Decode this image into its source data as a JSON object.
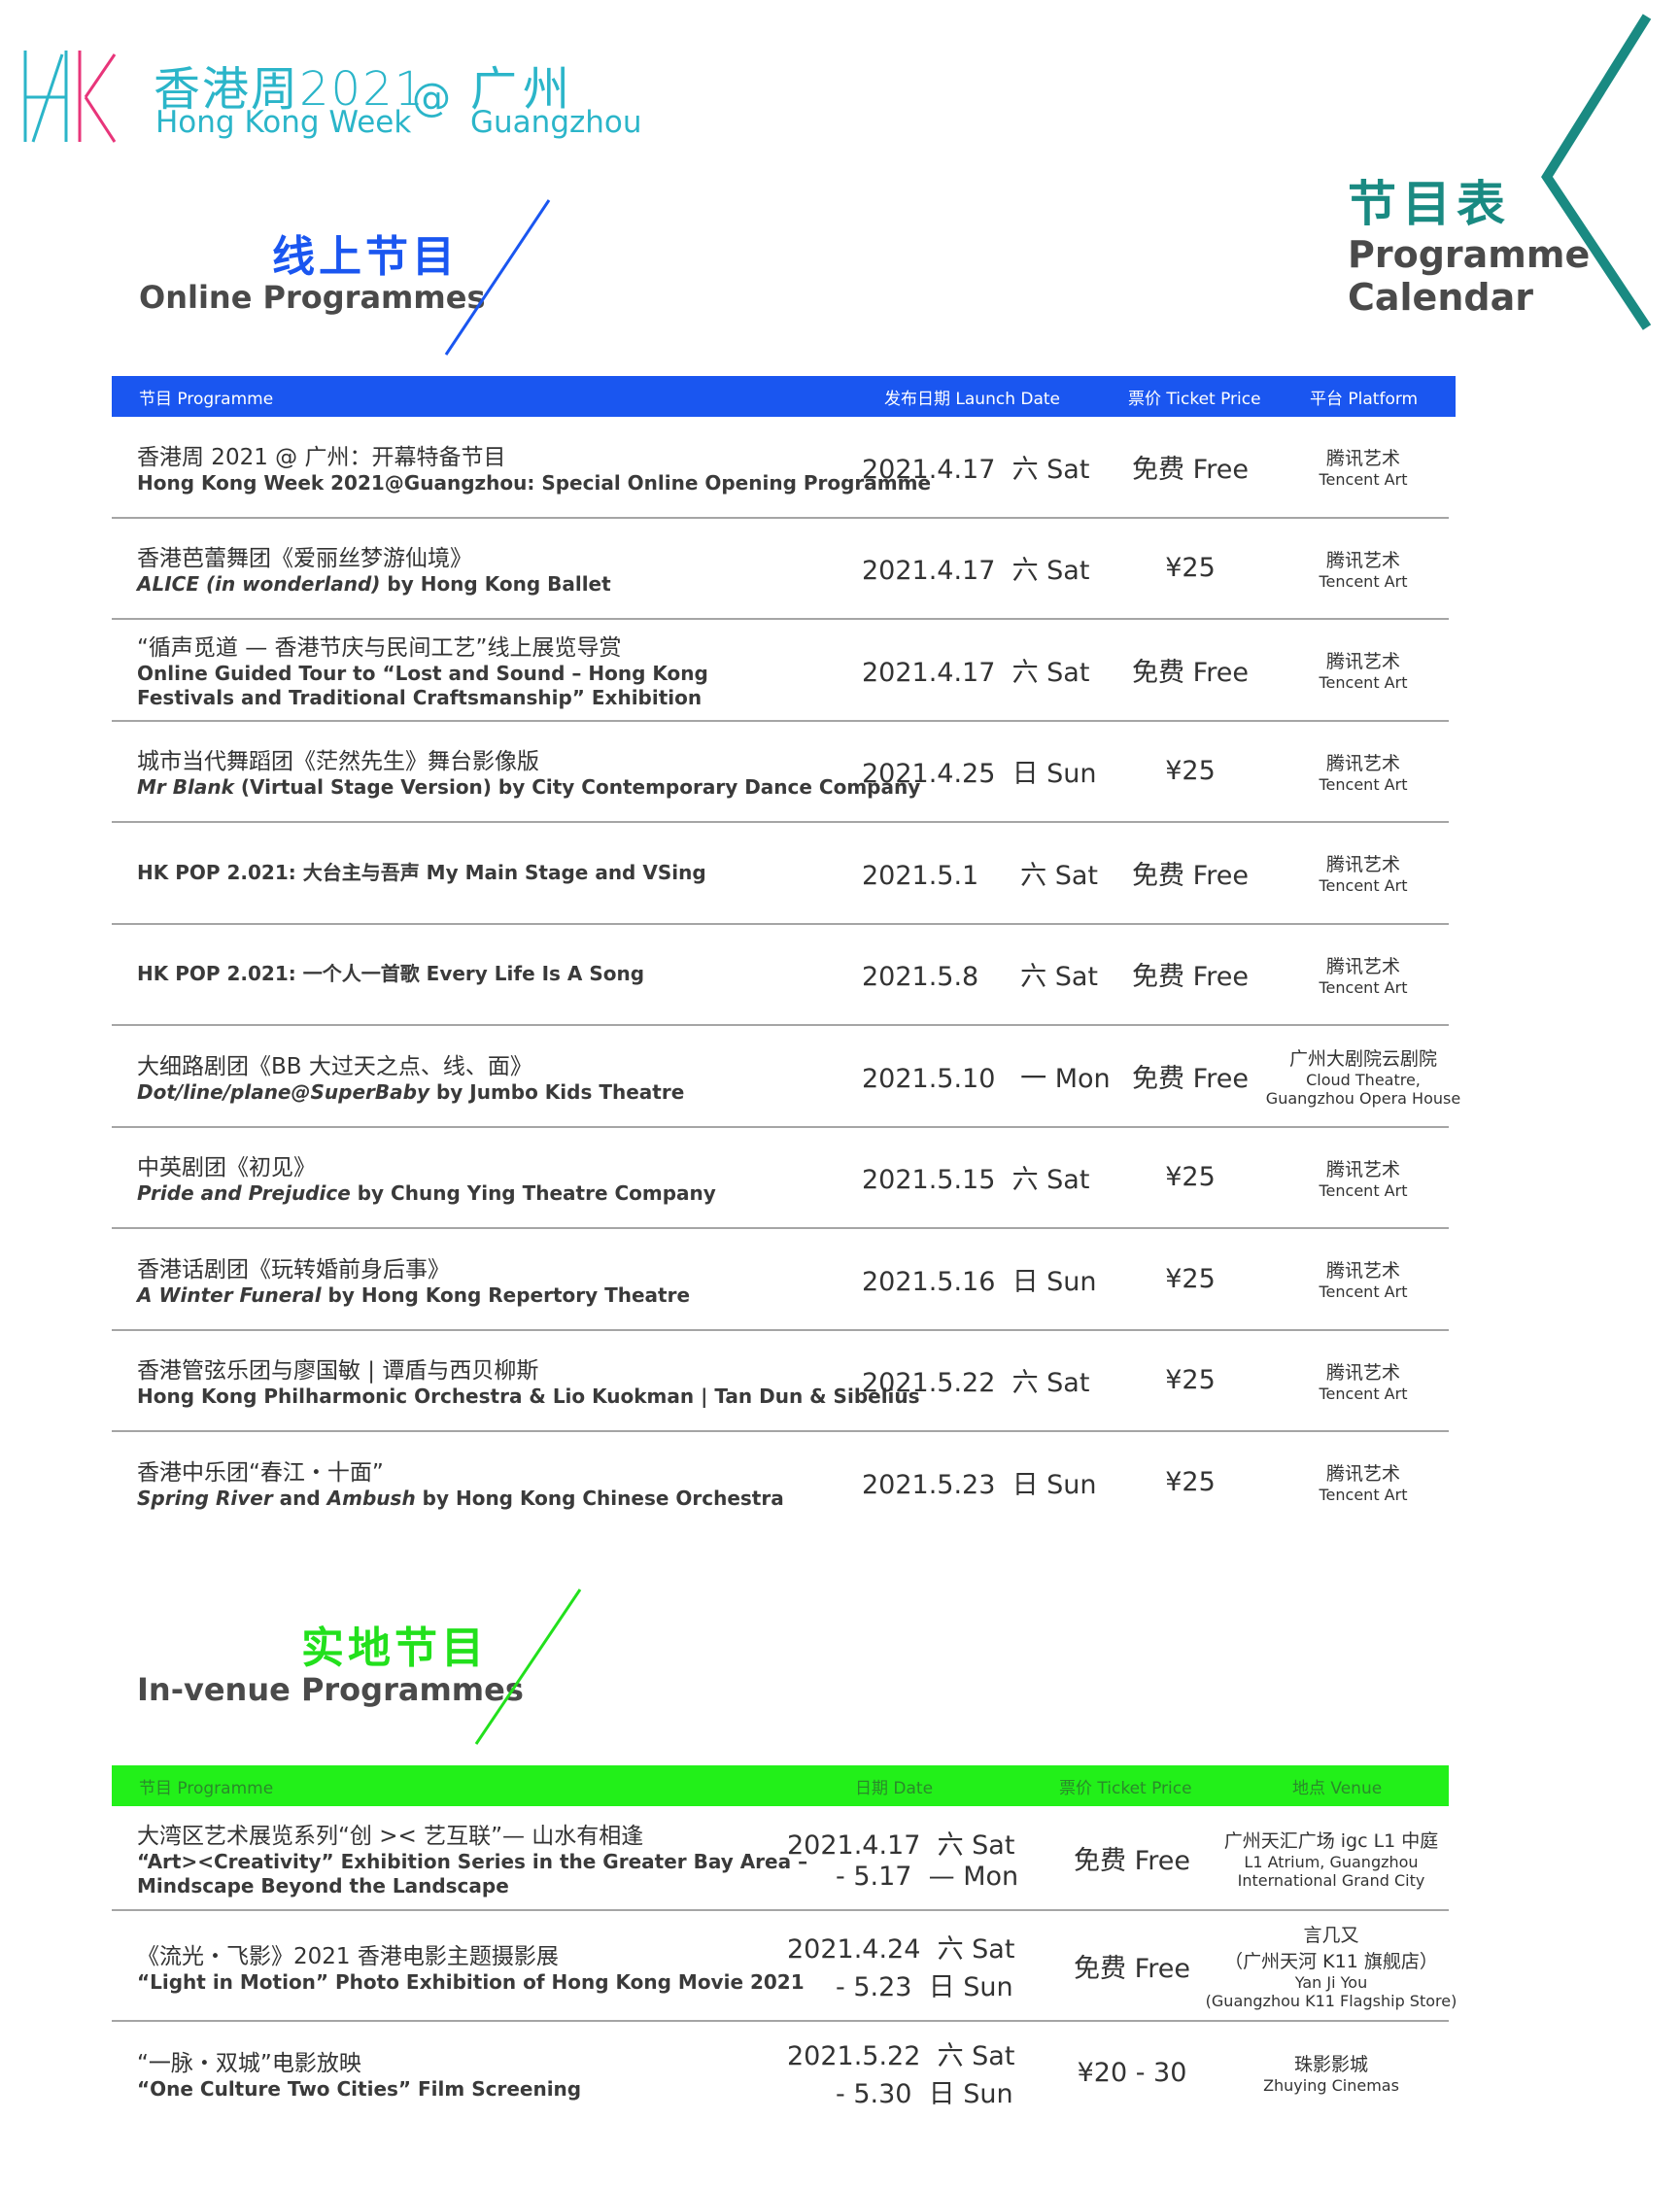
{
  "brand": {
    "logo_text": "HK",
    "title_cn": "香港周2021",
    "title_en": "Hong Kong Week",
    "at": "@",
    "city_cn": "广州",
    "city_en": "Guangzhou"
  },
  "calendar": {
    "title_cn": "节目表",
    "title_en_1": "Programme",
    "title_en_2": "Calendar"
  },
  "online": {
    "title_cn": "线上节目",
    "title_en": "Online Programmes",
    "accent": "#1a56f0",
    "headers": {
      "programme": "节目 Programme",
      "date": "发布日期 Launch Date",
      "price": "票价 Ticket Price",
      "platform": "平台 Platform"
    },
    "rows": [
      {
        "cn": "香港周 2021 @ 广州：开幕特备节目",
        "en_pre": "",
        "en_italic": "",
        "en_post": "Hong Kong Week 2021@Guangzhou: Special Online Opening Programme",
        "en_2": "",
        "date": "2021.4.17  六 Sat",
        "price": "免费 Free",
        "plat_cn": "腾讯艺术",
        "plat_en": "Tencent Art",
        "plat_en2": ""
      },
      {
        "cn": "香港芭蕾舞团《爱丽丝梦游仙境》",
        "en_pre": "",
        "en_italic": "ALICE (in wonderland)",
        "en_post": " by Hong Kong Ballet",
        "en_2": "",
        "date": "2021.4.17  六 Sat",
        "price": "¥25",
        "plat_cn": "腾讯艺术",
        "plat_en": "Tencent Art",
        "plat_en2": ""
      },
      {
        "cn": "“循声觅道 — 香港节庆与民间工艺”线上展览导赏",
        "en_pre": "",
        "en_italic": "",
        "en_post": "Online Guided Tour to “Lost and Sound – Hong Kong",
        "en_2": "Festivals and Traditional Craftsmanship” Exhibition",
        "date": "2021.4.17  六 Sat",
        "price": "免费 Free",
        "plat_cn": "腾讯艺术",
        "plat_en": "Tencent Art",
        "plat_en2": ""
      },
      {
        "cn": "城市当代舞蹈团《茫然先生》舞台影像版",
        "en_pre": "",
        "en_italic": "Mr Blank",
        "en_post": " (Virtual Stage Version) by City Contemporary Dance Company",
        "en_2": "",
        "date": "2021.4.25  日 Sun",
        "price": "¥25",
        "plat_cn": "腾讯艺术",
        "plat_en": "Tencent Art",
        "plat_en2": ""
      },
      {
        "cn": "",
        "en_pre": "",
        "en_italic": "",
        "en_post": "HK POP 2.021: 大台主与吾声 My Main Stage and VSing",
        "en_2": "",
        "date": "2021.5.1     六 Sat",
        "price": "免费 Free",
        "plat_cn": "腾讯艺术",
        "plat_en": "Tencent Art",
        "plat_en2": ""
      },
      {
        "cn": "",
        "en_pre": "",
        "en_italic": "",
        "en_post": "HK POP 2.021: 一个人一首歌 Every Life Is A Song",
        "en_2": "",
        "date": "2021.5.8     六 Sat",
        "price": "免费 Free",
        "plat_cn": "腾讯艺术",
        "plat_en": "Tencent Art",
        "plat_en2": ""
      },
      {
        "cn": "大细路剧团《BB 大过天之点、线、面》",
        "en_pre": "",
        "en_italic": "Dot/line/plane@SuperBaby",
        "en_post": " by Jumbo Kids Theatre",
        "en_2": "",
        "date": "2021.5.10   一 Mon",
        "price": "免费 Free",
        "plat_cn": "广州大剧院云剧院",
        "plat_en": "Cloud Theatre,",
        "plat_en2": "Guangzhou Opera House"
      },
      {
        "cn": "中英剧团《初见》",
        "en_pre": "",
        "en_italic": "Pride and Prejudice",
        "en_post": " by Chung Ying Theatre Company",
        "en_2": "",
        "date": "2021.5.15  六 Sat",
        "price": "¥25",
        "plat_cn": "腾讯艺术",
        "plat_en": "Tencent Art",
        "plat_en2": ""
      },
      {
        "cn": "香港话剧团《玩转婚前身后事》",
        "en_pre": "",
        "en_italic": "A Winter Funeral",
        "en_post": " by Hong Kong Repertory Theatre",
        "en_2": "",
        "date": "2021.5.16  日 Sun",
        "price": "¥25",
        "plat_cn": "腾讯艺术",
        "plat_en": "Tencent Art",
        "plat_en2": ""
      },
      {
        "cn": "香港管弦乐团与廖国敏 | 谭盾与西贝柳斯",
        "en_pre": "",
        "en_italic": "",
        "en_post": "Hong Kong Philharmonic Orchestra & Lio Kuokman | Tan Dun & Sibelius",
        "en_2": "",
        "date": "2021.5.22  六 Sat",
        "price": "¥25",
        "plat_cn": "腾讯艺术",
        "plat_en": "Tencent Art",
        "plat_en2": ""
      },
      {
        "cn": "香港中乐团“春江・十面”",
        "en_pre": "",
        "en_italic": "Spring River",
        "en_post": " and ",
        "en_italic2": "Ambush",
        "en_post2": " by Hong Kong Chinese Orchestra",
        "en_2": "",
        "date": "2021.5.23  日 Sun",
        "price": "¥25",
        "plat_cn": "腾讯艺术",
        "plat_en": "Tencent Art",
        "plat_en2": ""
      }
    ]
  },
  "venue": {
    "title_cn": "实地节目",
    "title_en": "In-venue Programmes",
    "accent": "#22e01c",
    "headers": {
      "programme": "节目 Programme",
      "date": "日期 Date",
      "price": "票价 Ticket Price",
      "venue": "地点 Venue"
    },
    "rows": [
      {
        "cn": "大湾区艺术展览系列“创 >< 艺互联”— 山水有相逢",
        "en_1": "“Art><Creativity” Exhibition Series in the Greater Bay Area –",
        "en_2": "Mindscape Beyond the Landscape",
        "date_1": "2021.4.17  六 Sat",
        "date_2": "- 5.17  — Mon",
        "price": "免费 Free",
        "v_cn": "广州天汇广场 igc L1 中庭",
        "v_en": "L1 Atrium, Guangzhou",
        "v_en2": "International Grand City",
        "v_en3": ""
      },
      {
        "cn": "《流光・飞影》2021 香港电影主题摄影展",
        "en_1": "“Light in Motion” Photo Exhibition of Hong Kong Movie 2021",
        "en_2": "",
        "date_1": "2021.4.24  六 Sat",
        "date_2": "- 5.23  日 Sun",
        "price": "免费 Free",
        "v_cn": "言几又",
        "v_en": "（广州天河 K11 旗舰店）",
        "v_en2": "Yan Ji You",
        "v_en3": "(Guangzhou K11 Flagship Store)"
      },
      {
        "cn": "“一脉・双城”电影放映",
        "en_1": "“One Culture Two Cities” Film Screening",
        "en_2": "",
        "date_1": "2021.5.22  六 Sat",
        "date_2": "- 5.30  日 Sun",
        "price": "¥20 - 30",
        "v_cn": "珠影影城",
        "v_en": "Zhuying Cinemas",
        "v_en2": "",
        "v_en3": ""
      }
    ]
  }
}
